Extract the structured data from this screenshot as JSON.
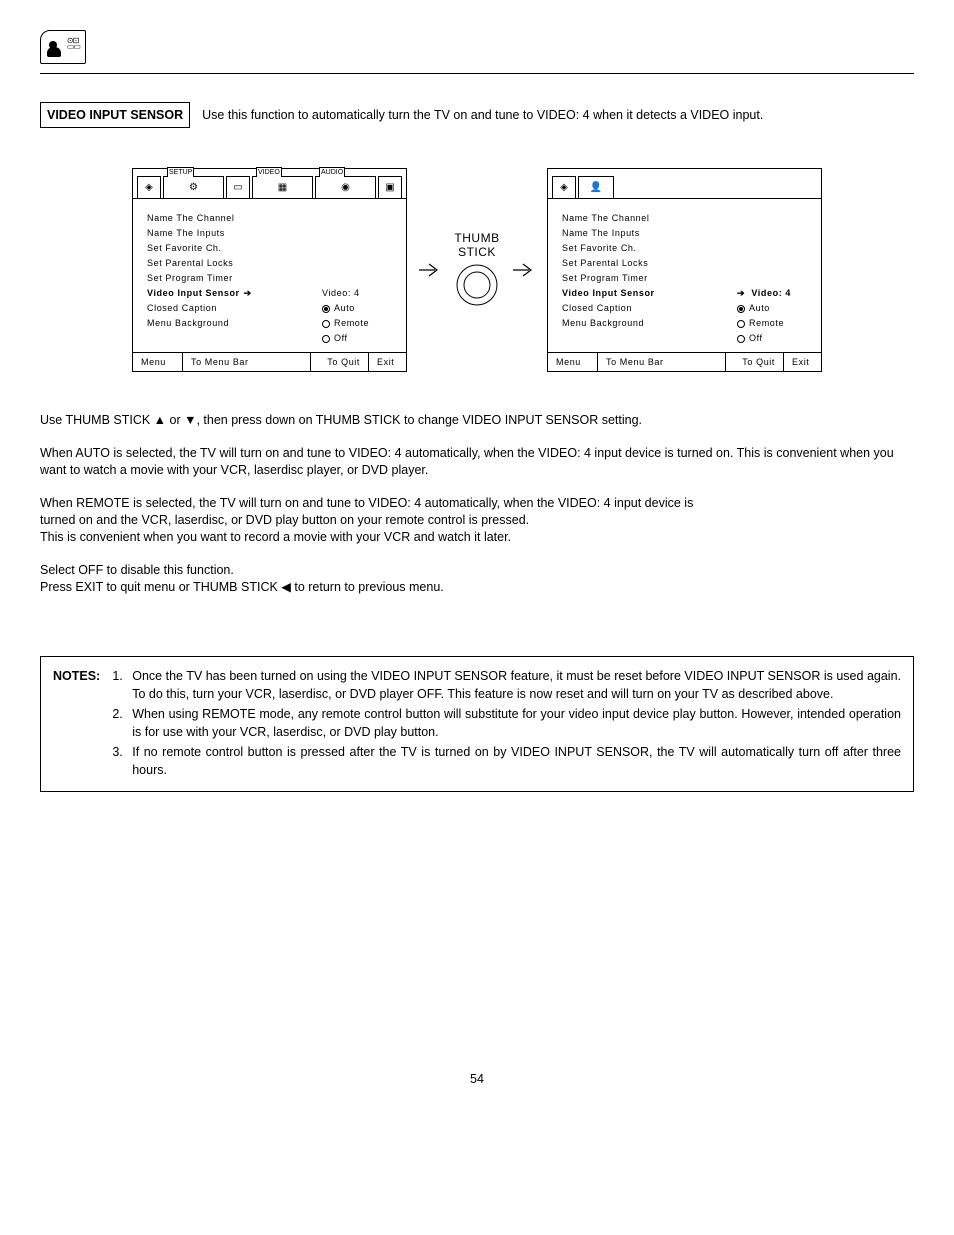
{
  "header": {
    "icon_name": "person-av-icon"
  },
  "section": {
    "title": "VIDEO INPUT SENSOR",
    "intro": "Use this function to automatically turn the TV on and tune to VIDEO: 4 when it detects a VIDEO input."
  },
  "thumb_label_1": "THUMB",
  "thumb_label_2": "STICK",
  "panel_left": {
    "tabs": [
      "SETUP",
      "VIDEO",
      "AUDIO"
    ],
    "items": [
      "Name The Channel",
      "Name The Inputs",
      "Set Favorite Ch.",
      "Set Parental Locks",
      "Set Program Timer",
      "Video Input Sensor",
      "Closed Caption",
      "Menu Background"
    ],
    "value_label": "Video: 4",
    "opt_auto": "Auto",
    "opt_remote": "Remote",
    "opt_off": "Off",
    "footer": {
      "menu": "Menu",
      "tomenu": "To Menu Bar",
      "toquit": "To Quit",
      "exit": "Exit"
    }
  },
  "panel_right": {
    "items": [
      "Name The Channel",
      "Name The Inputs",
      "Set Favorite Ch.",
      "Set Parental Locks",
      "Set Program Timer",
      "Video Input Sensor",
      "Closed Caption",
      "Menu Background"
    ],
    "value_label": "Video: 4",
    "opt_auto": "Auto",
    "opt_remote": "Remote",
    "opt_off": "Off",
    "footer": {
      "menu": "Menu",
      "tomenu": "To Menu Bar",
      "toquit": "To Quit",
      "exit": "Exit"
    }
  },
  "paragraphs": {
    "p1": "Use THUMB STICK ▲ or ▼, then press down on THUMB STICK to change VIDEO INPUT SENSOR setting.",
    "p2": "When AUTO is selected, the TV will turn on and tune to VIDEO: 4 automatically, when the VIDEO: 4 input device is turned on. This is convenient when you want to watch a movie with your VCR, laserdisc player, or DVD player.",
    "p3a": "When REMOTE is selected, the TV will turn on and tune to VIDEO: 4 automatically, when the VIDEO: 4 input device is",
    "p3b": "turned on and the VCR, laserdisc, or DVD play button on your remote control is pressed.",
    "p3c": "This is convenient when you want to record a movie with your VCR and watch it later.",
    "p4a": "Select OFF to disable this function.",
    "p4b": "Press EXIT to quit menu or THUMB STICK ◀ to return to previous menu."
  },
  "notes": {
    "label": "NOTES:",
    "items": [
      "Once the TV has been turned on using the VIDEO INPUT SENSOR feature, it must be reset before VIDEO INPUT SENSOR is used again. To do this, turn your VCR, laserdisc, or DVD player OFF. This feature is now reset and will turn on your TV as described above.",
      "When using REMOTE mode, any remote control button will substitute for your video input device play button. However, intended operation is for use with your VCR, laserdisc, or DVD play button.",
      "If no remote control button is pressed after the TV is turned on by VIDEO INPUT SENSOR, the TV will automatically turn off after three hours."
    ]
  },
  "page_number": "54"
}
